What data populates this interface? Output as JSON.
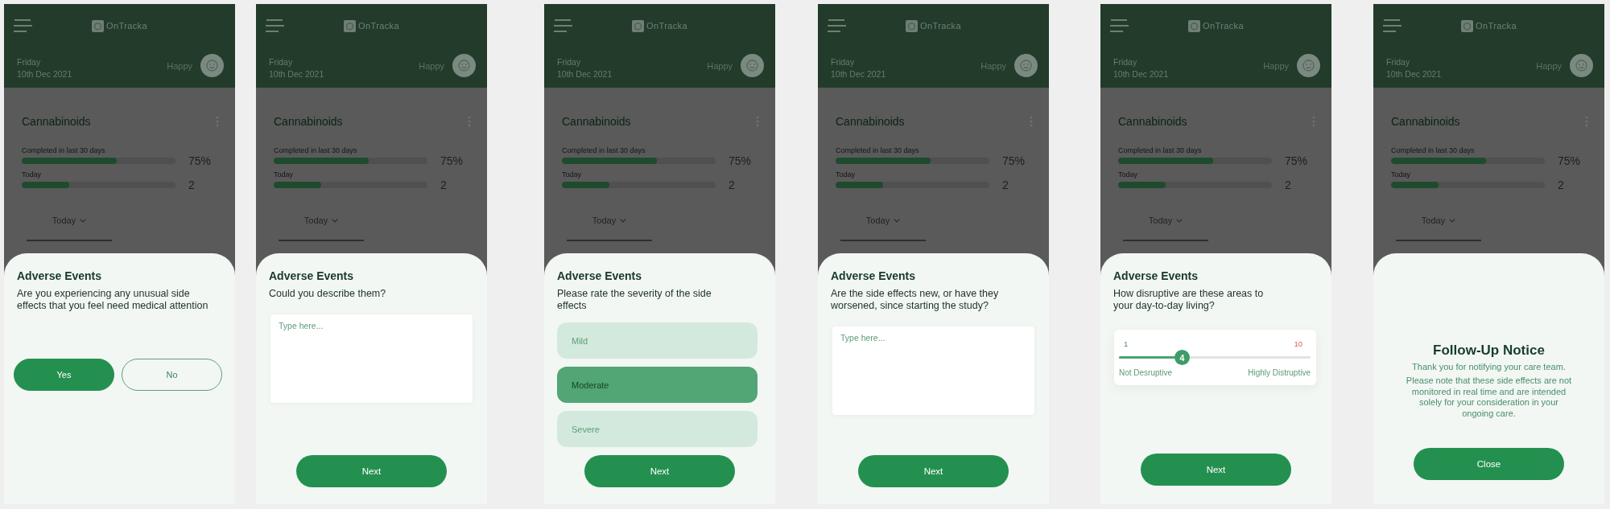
{
  "screens": [
    {
      "app": {
        "logo": "OnTracka",
        "day": "Friday",
        "date": "10th Dec 2021",
        "mood": "Happy",
        "card_title": "Cannabinoids",
        "metrics": [
          {
            "label": "Completed in last 30 days",
            "level": 0.62,
            "value": "75%"
          },
          {
            "label": "Today",
            "level": 0.31,
            "value": "2"
          }
        ],
        "tabs": [
          {
            "label": "Today",
            "selected": true
          }
        ]
      },
      "sheet": {
        "kind": "choice",
        "title": "Adverse Events",
        "question": "Are you experiencing any unusual side effects that you feel need medical attention",
        "options": [
          {
            "label": "Yes",
            "selected": true
          },
          {
            "label": "No",
            "selected": false
          }
        ]
      }
    },
    {
      "app": {
        "logo": "OnTracka",
        "day": "Friday",
        "date": "10th Dec 2021",
        "mood": "Happy",
        "card_title": "Cannabinoids",
        "metrics": [
          {
            "label": "Completed in last 30 days",
            "level": 0.62,
            "value": "75%"
          },
          {
            "label": "Today",
            "level": 0.31,
            "value": "2"
          }
        ],
        "tabs": [
          {
            "label": "Today",
            "selected": true
          }
        ]
      },
      "sheet": {
        "kind": "text",
        "title": "Adverse Events",
        "question": "Could you describe them?",
        "placeholder": "Type here...",
        "button": "Next"
      }
    },
    {
      "app": {
        "logo": "OnTracka",
        "day": "Friday",
        "date": "10th Dec 2021",
        "mood": "Happy",
        "card_title": "Cannabinoids",
        "metrics": [
          {
            "label": "Completed in last 30 days",
            "level": 0.62,
            "value": "75%"
          },
          {
            "label": "Today",
            "level": 0.31,
            "value": "2"
          }
        ],
        "tabs": [
          {
            "label": "Today",
            "selected": true
          }
        ]
      },
      "sheet": {
        "kind": "options",
        "title": "Adverse Events",
        "question": "Please rate the severity of the side effects",
        "options": [
          {
            "label": "Mild",
            "selected": false
          },
          {
            "label": "Moderate",
            "selected": true
          },
          {
            "label": "Severe",
            "selected": false
          }
        ],
        "button": "Next"
      }
    },
    {
      "app": {
        "logo": "OnTracka",
        "day": "Friday",
        "date": "10th Dec 2021",
        "mood": "Happy",
        "card_title": "Cannabinoids",
        "metrics": [
          {
            "label": "Completed in last 30 days",
            "level": 0.62,
            "value": "75%"
          },
          {
            "label": "Today",
            "level": 0.31,
            "value": "2"
          }
        ],
        "tabs": [
          {
            "label": "Today",
            "selected": true
          }
        ]
      },
      "sheet": {
        "kind": "text",
        "title": "Adverse Events",
        "question": "Are the side effects new, or have they worsened, since starting the study?",
        "placeholder": "Type here...",
        "button": "Next"
      }
    },
    {
      "app": {
        "logo": "OnTracka",
        "day": "Friday",
        "date": "10th Dec 2021",
        "mood": "Happy",
        "card_title": "Cannabinoids",
        "metrics": [
          {
            "label": "Completed in last 30 days",
            "level": 0.62,
            "value": "75%"
          },
          {
            "label": "Today",
            "level": 0.31,
            "value": "2"
          }
        ],
        "tabs": [
          {
            "label": "Today",
            "selected": true
          }
        ]
      },
      "sheet": {
        "kind": "slider",
        "title": "Adverse Events",
        "question": "How disruptive are these areas to your day-to-day living?",
        "slider": {
          "min": "1",
          "max": "10",
          "value": "4",
          "level": 0.33,
          "min_label": "Not Desruptive",
          "max_label": "Highly Distruptive"
        },
        "button": "Next"
      }
    },
    {
      "app": {
        "logo": "OnTracka",
        "day": "Friday",
        "date": "10th Dec 2021",
        "mood": "Happy",
        "card_title": "Cannabinoids",
        "metrics": [
          {
            "label": "Completed in last 30 days",
            "level": 0.62,
            "value": "75%"
          },
          {
            "label": "Today",
            "level": 0.31,
            "value": "2"
          }
        ],
        "tabs": [
          {
            "label": "Today",
            "selected": true
          }
        ]
      },
      "sheet": {
        "kind": "notice",
        "title": "Follow-Up Notice",
        "message": "Thank you for notifying your care team.",
        "note": "Please note that these side effects are not monitored in real time and are intended solely for your consideration in your ongoing care.",
        "button": "Close"
      }
    }
  ]
}
